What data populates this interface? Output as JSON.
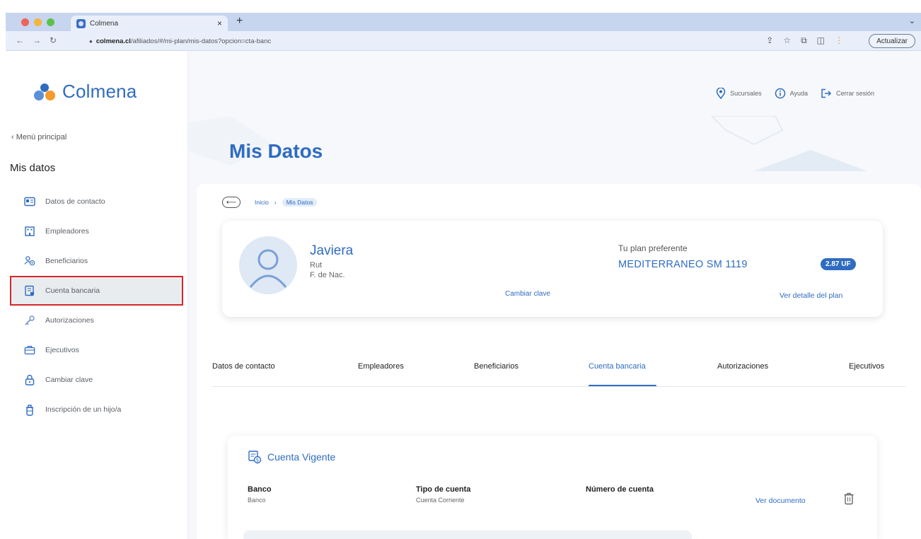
{
  "browser": {
    "tab_title": "Colmena",
    "tab_close": "×",
    "new_tab": "+",
    "url_domain": "colmena.cl",
    "url_path": "/afiliados/#/mi-plan/mis-datos?opcion=cta-banc",
    "update_label": "Actualizar"
  },
  "brand": {
    "name": "Colmena",
    "color": "#2f6cc1"
  },
  "sidebar": {
    "back_label": "‹ Menú principal",
    "section_title": "Mis datos",
    "items": [
      {
        "label": "Datos de contacto",
        "icon": "contact-card-icon",
        "active": false
      },
      {
        "label": "Empleadores",
        "icon": "building-icon",
        "active": false
      },
      {
        "label": "Beneficiarios",
        "icon": "beneficiaries-icon",
        "active": false
      },
      {
        "label": "Cuenta bancaria",
        "icon": "bank-account-icon",
        "active": true
      },
      {
        "label": "Autorizaciones",
        "icon": "key-icon",
        "active": false
      },
      {
        "label": "Ejecutivos",
        "icon": "briefcase-icon",
        "active": false
      },
      {
        "label": "Cambiar clave",
        "icon": "lock-icon",
        "active": false
      },
      {
        "label": "Inscripción de un hijo/a",
        "icon": "baby-bottle-icon",
        "active": false
      }
    ]
  },
  "header": {
    "links": [
      {
        "label": "Sucursales",
        "icon": "location-pin-icon"
      },
      {
        "label": "Ayuda",
        "icon": "info-circle-icon"
      },
      {
        "label": "Cerrar sesión",
        "icon": "logout-icon"
      }
    ]
  },
  "page": {
    "title": "Mis Datos",
    "breadcrumb": {
      "home": "Inicio",
      "separator": "›",
      "current": "Mis Datos"
    }
  },
  "profile": {
    "name": "Javiera",
    "rut_label": "Rut",
    "birth_label": "F. de Nac.",
    "change_password": "Cambiar clave",
    "plan_label": "Tu plan preferente",
    "plan_name": "MEDITERRANEO SM 1119",
    "plan_price": "2.87 UF",
    "plan_detail_link": "Ver detalle del plan"
  },
  "tabs": [
    {
      "label": "Datos de contacto",
      "active": false
    },
    {
      "label": "Empleadores",
      "active": false
    },
    {
      "label": "Beneficiarios",
      "active": false
    },
    {
      "label": "Cuenta bancaria",
      "active": true
    },
    {
      "label": "Autorizaciones",
      "active": false
    },
    {
      "label": "Ejecutivos",
      "active": false
    }
  ],
  "account": {
    "title": "Cuenta Vigente",
    "columns": [
      {
        "header": "Banco",
        "value": "Banco"
      },
      {
        "header": "Tipo de cuenta",
        "value": "Cuenta Corriente"
      },
      {
        "header": "Número de cuenta",
        "value": ""
      }
    ],
    "view_document": "Ver documento"
  }
}
